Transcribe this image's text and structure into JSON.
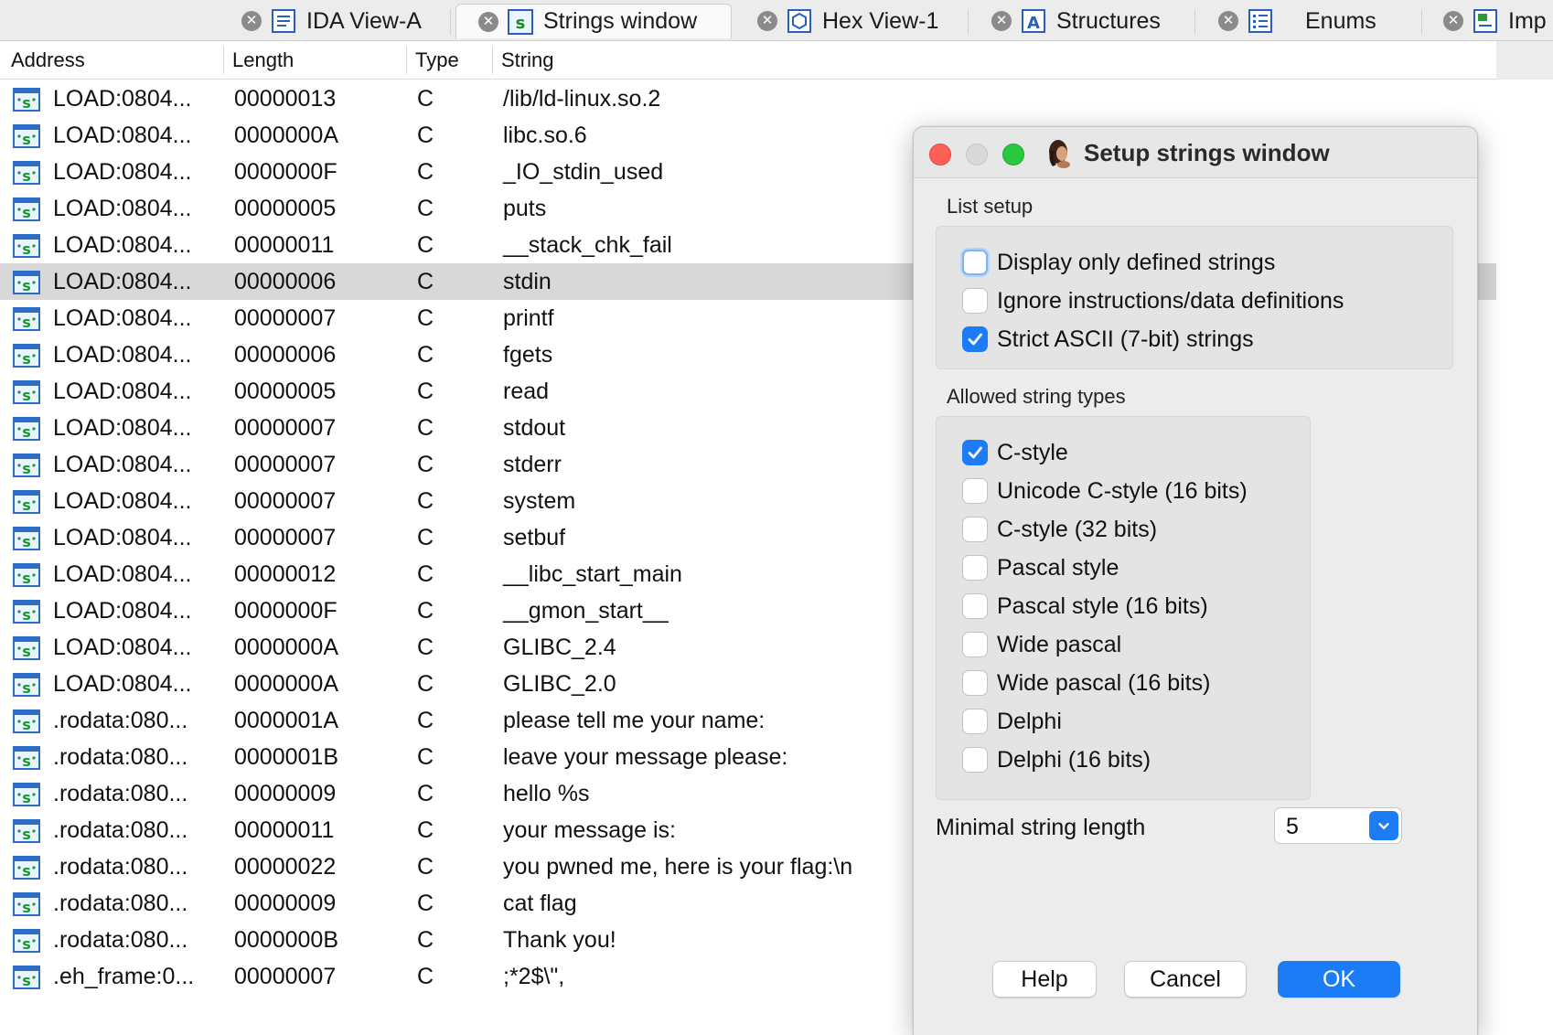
{
  "tabs": [
    {
      "label": "IDA View-A",
      "icon": "ida-view-icon",
      "active": false
    },
    {
      "label": "Strings window",
      "icon": "strings-icon",
      "active": true
    },
    {
      "label": "Hex View-1",
      "icon": "hex-view-icon",
      "active": false
    },
    {
      "label": "Structures",
      "icon": "structures-icon",
      "active": false
    },
    {
      "label": "Enums",
      "icon": "enums-icon",
      "active": false
    },
    {
      "label": "Imp",
      "icon": "imports-icon",
      "active": false
    }
  ],
  "table": {
    "columns": [
      "Address",
      "Length",
      "Type",
      "String"
    ],
    "selected_row": 5,
    "rows": [
      {
        "address": "LOAD:0804...",
        "length": "00000013",
        "type": "C",
        "string": "/lib/ld-linux.so.2"
      },
      {
        "address": "LOAD:0804...",
        "length": "0000000A",
        "type": "C",
        "string": "libc.so.6"
      },
      {
        "address": "LOAD:0804...",
        "length": "0000000F",
        "type": "C",
        "string": "_IO_stdin_used"
      },
      {
        "address": "LOAD:0804...",
        "length": "00000005",
        "type": "C",
        "string": "puts"
      },
      {
        "address": "LOAD:0804...",
        "length": "00000011",
        "type": "C",
        "string": "__stack_chk_fail"
      },
      {
        "address": "LOAD:0804...",
        "length": "00000006",
        "type": "C",
        "string": "stdin"
      },
      {
        "address": "LOAD:0804...",
        "length": "00000007",
        "type": "C",
        "string": "printf"
      },
      {
        "address": "LOAD:0804...",
        "length": "00000006",
        "type": "C",
        "string": "fgets"
      },
      {
        "address": "LOAD:0804...",
        "length": "00000005",
        "type": "C",
        "string": "read"
      },
      {
        "address": "LOAD:0804...",
        "length": "00000007",
        "type": "C",
        "string": "stdout"
      },
      {
        "address": "LOAD:0804...",
        "length": "00000007",
        "type": "C",
        "string": "stderr"
      },
      {
        "address": "LOAD:0804...",
        "length": "00000007",
        "type": "C",
        "string": "system"
      },
      {
        "address": "LOAD:0804...",
        "length": "00000007",
        "type": "C",
        "string": "setbuf"
      },
      {
        "address": "LOAD:0804...",
        "length": "00000012",
        "type": "C",
        "string": "__libc_start_main"
      },
      {
        "address": "LOAD:0804...",
        "length": "0000000F",
        "type": "C",
        "string": "__gmon_start__"
      },
      {
        "address": "LOAD:0804...",
        "length": "0000000A",
        "type": "C",
        "string": "GLIBC_2.4"
      },
      {
        "address": "LOAD:0804...",
        "length": "0000000A",
        "type": "C",
        "string": "GLIBC_2.0"
      },
      {
        "address": ".rodata:080...",
        "length": "0000001A",
        "type": "C",
        "string": "please tell me your name:"
      },
      {
        "address": ".rodata:080...",
        "length": "0000001B",
        "type": "C",
        "string": "leave your message please:"
      },
      {
        "address": ".rodata:080...",
        "length": "00000009",
        "type": "C",
        "string": "hello %s"
      },
      {
        "address": ".rodata:080...",
        "length": "00000011",
        "type": "C",
        "string": "your message is:"
      },
      {
        "address": ".rodata:080...",
        "length": "00000022",
        "type": "C",
        "string": "you pwned me, here is your flag:\\n"
      },
      {
        "address": ".rodata:080...",
        "length": "00000009",
        "type": "C",
        "string": "cat flag"
      },
      {
        "address": ".rodata:080...",
        "length": "0000000B",
        "type": "C",
        "string": "Thank you!"
      },
      {
        "address": ".eh_frame:0...",
        "length": "00000007",
        "type": "C",
        "string": ";*2$\\\","
      }
    ]
  },
  "dialog": {
    "title": "Setup strings window",
    "list_setup_label": "List setup",
    "list_setup": [
      {
        "label": "Display only defined strings",
        "checked": false,
        "focused": true
      },
      {
        "label": "Ignore instructions/data definitions",
        "checked": false,
        "focused": false
      },
      {
        "label": "Strict ASCII (7-bit) strings",
        "checked": true,
        "focused": false
      }
    ],
    "string_types_label": "Allowed string types",
    "string_types": [
      {
        "label": "C-style",
        "checked": true
      },
      {
        "label": "Unicode C-style (16 bits)",
        "checked": false
      },
      {
        "label": "C-style (32 bits)",
        "checked": false
      },
      {
        "label": "Pascal style",
        "checked": false
      },
      {
        "label": "Pascal style (16 bits)",
        "checked": false
      },
      {
        "label": "Wide pascal",
        "checked": false
      },
      {
        "label": "Wide pascal (16 bits)",
        "checked": false
      },
      {
        "label": "Delphi",
        "checked": false
      },
      {
        "label": "Delphi (16 bits)",
        "checked": false
      }
    ],
    "min_length_label": "Minimal string length",
    "min_length_value": "5",
    "buttons": {
      "help": "Help",
      "cancel": "Cancel",
      "ok": "OK"
    }
  },
  "colors": {
    "accent": "#1b7cf6",
    "selected_row": "#d8d8d8",
    "close_red": "#fe5f57",
    "zoom_green": "#28c840"
  }
}
